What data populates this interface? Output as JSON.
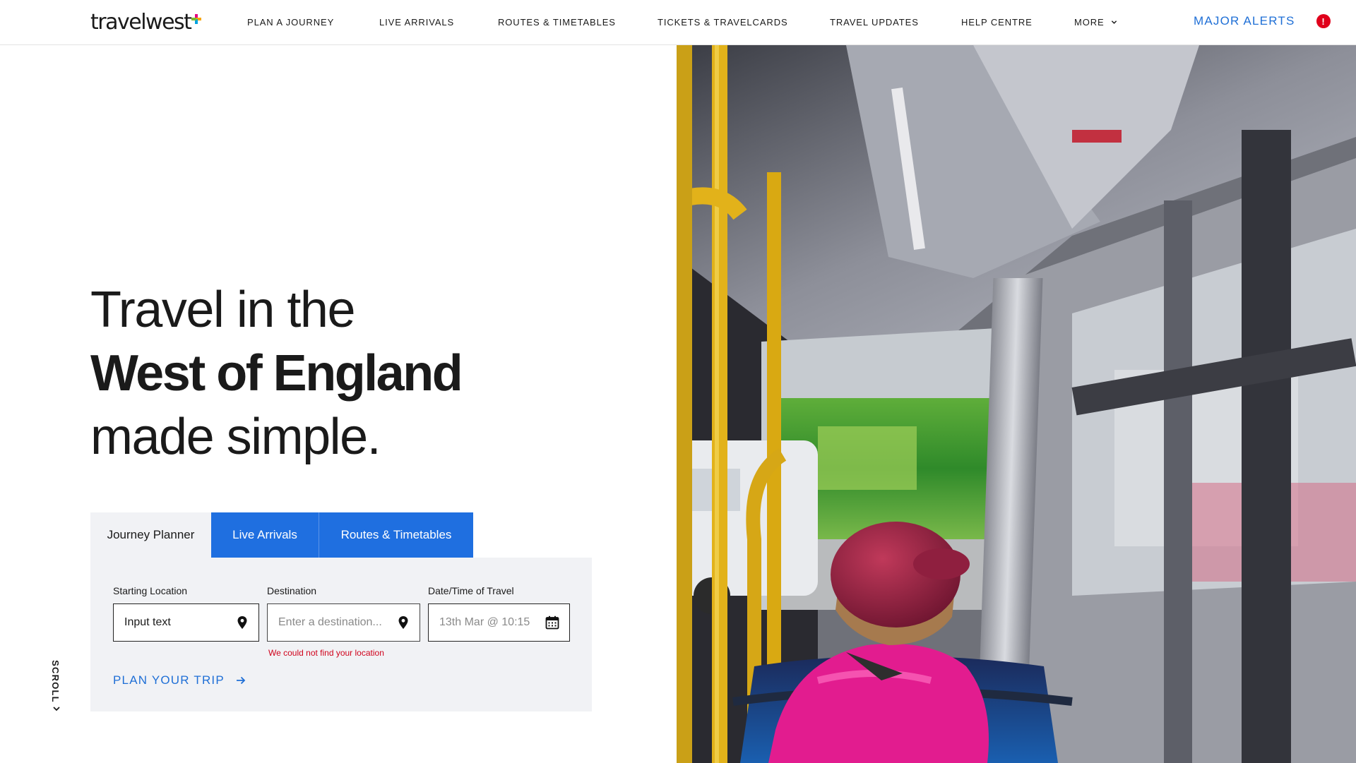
{
  "header": {
    "logo_text": "travelwest",
    "logo_plus_colors": [
      "#e6007e",
      "#f7a600",
      "#00a3e0",
      "#7cb82f"
    ],
    "nav": [
      {
        "label": "PLAN A JOURNEY"
      },
      {
        "label": "LIVE ARRIVALS"
      },
      {
        "label": "ROUTES & TIMETABLES"
      },
      {
        "label": "TICKETS & TRAVELCARDS"
      },
      {
        "label": "TRAVEL UPDATES"
      },
      {
        "label": "HELP CENTRE"
      },
      {
        "label": "MORE",
        "icon": "chevron-down-icon"
      }
    ],
    "alerts_label": "MAJOR ALERTS",
    "alerts_badge": "!",
    "alerts_badge_color": "#e0001b"
  },
  "hero": {
    "line1": "Travel in the",
    "line2": "West of England",
    "line3": "made simple."
  },
  "planner": {
    "tabs": [
      {
        "label": "Journey Planner",
        "active": true
      },
      {
        "label": "Live Arrivals",
        "active": false
      },
      {
        "label": "Routes & Timetables",
        "active": false
      }
    ],
    "start": {
      "label": "Starting Location",
      "value": "Input text",
      "icon": "map-pin-icon"
    },
    "destination": {
      "label": "Destination",
      "placeholder": "Enter a destination...",
      "icon": "map-pin-icon",
      "error": "We could not find your location"
    },
    "datetime": {
      "label": "Date/Time of Travel",
      "placeholder": "13th Mar @ 10:15",
      "icon": "calendar-icon"
    },
    "submit_label": "PLAN YOUR TRIP",
    "submit_icon": "arrow-right-icon"
  },
  "scroll": {
    "label": "SCROLL",
    "icon": "chevron-down-icon"
  },
  "colors": {
    "accent": "#1f6fe0",
    "link": "#1f6fd6",
    "error": "#d0021b",
    "panel": "#f1f2f5"
  }
}
